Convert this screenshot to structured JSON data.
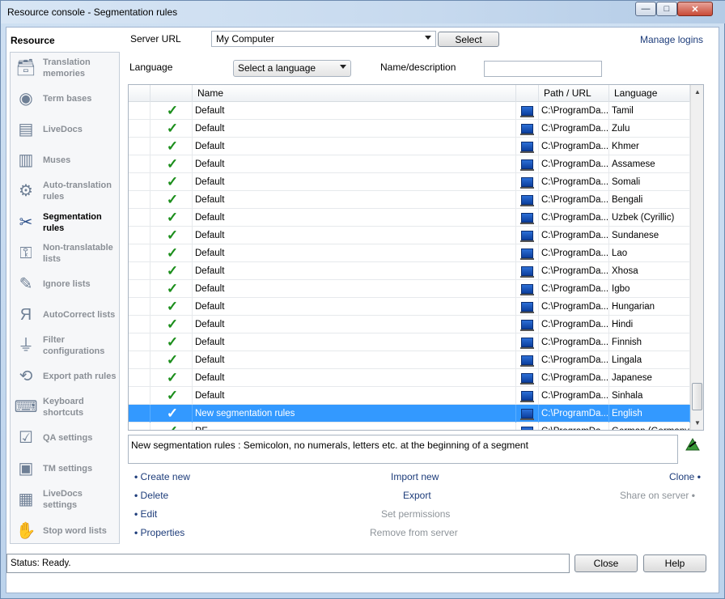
{
  "window": {
    "title": "Resource console - Segmentation rules",
    "controls": {
      "minimize": "—",
      "maximize": "□",
      "close": "✕"
    }
  },
  "sidebar": {
    "header": "Resource",
    "items": [
      {
        "label": "Translation memories",
        "icon": "translation-memories-icon",
        "active": false
      },
      {
        "label": "Term bases",
        "icon": "term-bases-icon",
        "active": false
      },
      {
        "label": "LiveDocs",
        "icon": "livedocs-icon",
        "active": false
      },
      {
        "label": "Muses",
        "icon": "muses-icon",
        "active": false
      },
      {
        "label": "Auto-translation rules",
        "icon": "auto-translation-icon",
        "active": false
      },
      {
        "label": "Segmentation rules",
        "icon": "segmentation-icon",
        "active": true
      },
      {
        "label": "Non-translatable lists",
        "icon": "non-translatable-icon",
        "active": false
      },
      {
        "label": "Ignore lists",
        "icon": "ignore-lists-icon",
        "active": false
      },
      {
        "label": "AutoCorrect lists",
        "icon": "autocorrect-icon",
        "active": false
      },
      {
        "label": "Filter configurations",
        "icon": "filter-icon",
        "active": false
      },
      {
        "label": "Export path rules",
        "icon": "export-path-icon",
        "active": false
      },
      {
        "label": "Keyboard shortcuts",
        "icon": "keyboard-icon",
        "active": false
      },
      {
        "label": "QA settings",
        "icon": "qa-settings-icon",
        "active": false
      },
      {
        "label": "TM settings",
        "icon": "tm-settings-icon",
        "active": false
      },
      {
        "label": "LiveDocs settings",
        "icon": "livedocs-settings-icon",
        "active": false
      },
      {
        "label": "Stop word lists",
        "icon": "stop-word-icon",
        "active": false
      }
    ]
  },
  "server": {
    "label": "Server URL",
    "value": "My Computer",
    "select_button": "Select",
    "manage_logins": "Manage logins"
  },
  "filters": {
    "language_label": "Language",
    "language_value": "Select a language",
    "name_label": "Name/description",
    "name_value": ""
  },
  "table": {
    "columns": [
      "",
      "",
      "Name",
      "",
      "Path / URL",
      "Language"
    ],
    "rows": [
      {
        "name": "Default",
        "path": "C:\\ProgramDa...",
        "language": "Tamil",
        "selected": false
      },
      {
        "name": "Default",
        "path": "C:\\ProgramDa...",
        "language": "Zulu",
        "selected": false
      },
      {
        "name": "Default",
        "path": "C:\\ProgramDa...",
        "language": "Khmer",
        "selected": false
      },
      {
        "name": "Default",
        "path": "C:\\ProgramDa...",
        "language": "Assamese",
        "selected": false
      },
      {
        "name": "Default",
        "path": "C:\\ProgramDa...",
        "language": "Somali",
        "selected": false
      },
      {
        "name": "Default",
        "path": "C:\\ProgramDa...",
        "language": "Bengali",
        "selected": false
      },
      {
        "name": "Default",
        "path": "C:\\ProgramDa...",
        "language": "Uzbek (Cyrillic)",
        "selected": false
      },
      {
        "name": "Default",
        "path": "C:\\ProgramDa...",
        "language": "Sundanese",
        "selected": false
      },
      {
        "name": "Default",
        "path": "C:\\ProgramDa...",
        "language": "Lao",
        "selected": false
      },
      {
        "name": "Default",
        "path": "C:\\ProgramDa...",
        "language": "Xhosa",
        "selected": false
      },
      {
        "name": "Default",
        "path": "C:\\ProgramDa...",
        "language": "Igbo",
        "selected": false
      },
      {
        "name": "Default",
        "path": "C:\\ProgramDa...",
        "language": "Hungarian",
        "selected": false
      },
      {
        "name": "Default",
        "path": "C:\\ProgramDa...",
        "language": "Hindi",
        "selected": false
      },
      {
        "name": "Default",
        "path": "C:\\ProgramDa...",
        "language": "Finnish",
        "selected": false
      },
      {
        "name": "Default",
        "path": "C:\\ProgramDa...",
        "language": "Lingala",
        "selected": false
      },
      {
        "name": "Default",
        "path": "C:\\ProgramDa...",
        "language": "Japanese",
        "selected": false
      },
      {
        "name": "Default",
        "path": "C:\\ProgramDa...",
        "language": "Sinhala",
        "selected": false
      },
      {
        "name": "New segmentation rules",
        "path": "C:\\ProgramDa...",
        "language": "English",
        "selected": true
      },
      {
        "name": "RE...",
        "path": "C:\\ProgramDa...",
        "language": "German (Germany)",
        "selected": false
      }
    ]
  },
  "description": "New segmentation rules : Semicolon, no numerals, letters etc. at the beginning of a segment",
  "actions": {
    "create_new": "Create new",
    "delete": "Delete",
    "edit": "Edit",
    "properties": "Properties",
    "import_new": "Import new",
    "export": "Export",
    "set_permissions": "Set permissions",
    "remove_from_server": "Remove from server",
    "clone": "Clone",
    "share_on_server": "Share on server",
    "bullet": "•"
  },
  "footer": {
    "status": "Status: Ready.",
    "close": "Close",
    "help": "Help"
  },
  "colors": {
    "selection": "#3399ff",
    "link": "#1d3c7a",
    "disabled": "#8e949a",
    "check": "#1b8e1b"
  }
}
